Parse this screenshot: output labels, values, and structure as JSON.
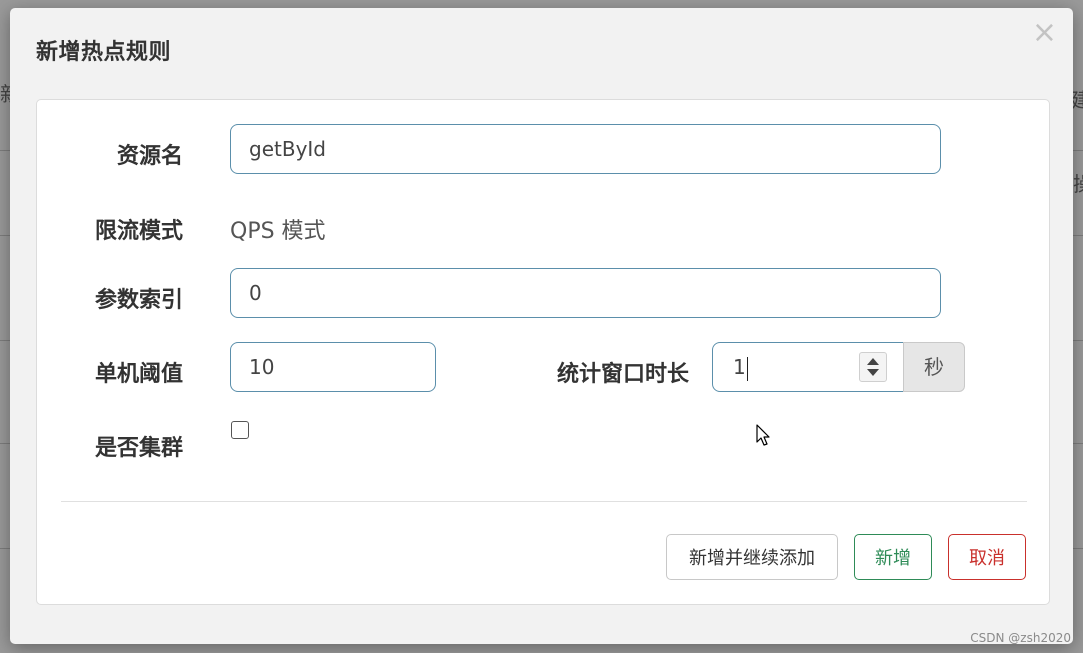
{
  "dialog": {
    "title": "新增热点规则",
    "close_label": "×"
  },
  "form": {
    "resource_name_label": "资源名",
    "resource_name_value": "getById",
    "mode_label": "限流模式",
    "mode_value": "QPS 模式",
    "param_index_label": "参数索引",
    "param_index_value": "0",
    "threshold_label": "单机阈值",
    "threshold_value": "10",
    "window_label": "统计窗口时长",
    "window_value": "1",
    "window_unit": "秒",
    "cluster_label": "是否集群",
    "cluster_checked": false
  },
  "buttons": {
    "continue_label": "新增并继续添加",
    "add_label": "新增",
    "cancel_label": "取消"
  },
  "colors": {
    "input_border": "#5b8fab",
    "add_button": "#2e8b57",
    "cancel_button": "#c9302c"
  },
  "background": {
    "char_top": "新",
    "char_right_top": "建",
    "char_right_mid": "操"
  },
  "watermark": "CSDN @zsh2020"
}
